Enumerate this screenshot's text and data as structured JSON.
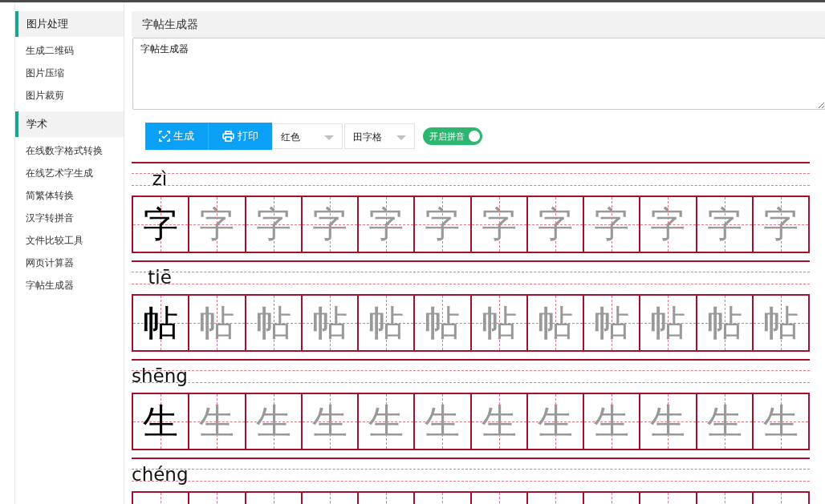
{
  "sidebar": {
    "sections": [
      {
        "title": "图片处理",
        "items": [
          {
            "label": "生成二维码"
          },
          {
            "label": "图片压缩"
          },
          {
            "label": "图片裁剪"
          }
        ]
      },
      {
        "title": "学术",
        "items": [
          {
            "label": "在线数字格式转换"
          },
          {
            "label": "在线艺术字生成"
          },
          {
            "label": "简繁体转换"
          },
          {
            "label": "汉字转拼音"
          },
          {
            "label": "文件比较工具"
          },
          {
            "label": "网页计算器"
          },
          {
            "label": "字帖生成器"
          }
        ]
      }
    ]
  },
  "panel": {
    "title": "字帖生成器",
    "input": {
      "value": "字帖生成器"
    }
  },
  "toolbar": {
    "buttons": [
      {
        "kind": "generate",
        "label": "生成"
      },
      {
        "kind": "print",
        "label": "打印"
      }
    ],
    "selects": [
      {
        "value": "红色"
      },
      {
        "value": "田字格"
      }
    ],
    "toggle": {
      "label": "开启拼音",
      "on": true
    }
  },
  "sheet": {
    "rows": [
      {
        "pinyin": "zì",
        "model": "字",
        "traces": [
          "字",
          "字",
          "字",
          "字",
          "字",
          "字",
          "字",
          "字",
          "字",
          "字",
          "字"
        ]
      },
      {
        "pinyin": "tiē",
        "model": "帖",
        "traces": [
          "帖",
          "帖",
          "帖",
          "帖",
          "帖",
          "帖",
          "帖",
          "帖",
          "帖",
          "帖",
          "帖"
        ]
      },
      {
        "pinyin": "shēng",
        "model": "生",
        "traces": [
          "生",
          "生",
          "生",
          "生",
          "生",
          "生",
          "生",
          "生",
          "生",
          "生",
          "生"
        ]
      },
      {
        "pinyin": "chéng"
      }
    ]
  }
}
